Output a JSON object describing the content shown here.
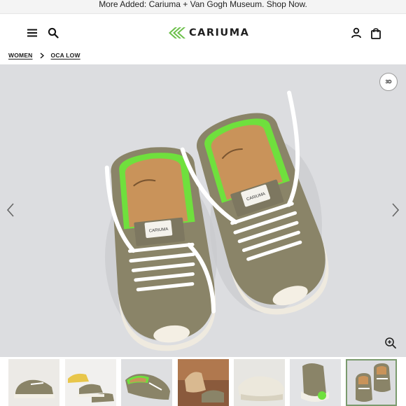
{
  "announcement": {
    "text": "More Added: Cariuma + Van Gogh Museum. Shop Now."
  },
  "header": {
    "logo_text": "CARIUMA",
    "icons": [
      "menu-icon",
      "search-icon",
      "user-icon",
      "shopping-bag-icon"
    ]
  },
  "breadcrumb": {
    "items": [
      "WOMEN",
      "OCA LOW"
    ]
  },
  "gallery": {
    "view_3d_label": "3D",
    "icons": [
      "chevron-left-icon",
      "chevron-right-icon",
      "zoom-in-icon",
      "3d-view-icon"
    ],
    "main_image": "Pair of khaki canvas low-top sneakers with white laces and cork insoles, top-down view",
    "thumbnails_count": 7,
    "active_thumbnail": 7
  },
  "colors": {
    "brand_green": "#6cc04a",
    "stage_background": "#dcdde0",
    "shoe_canvas": "#8a8468",
    "insole_cork": "#c9935a",
    "lining_green": "#7be04a",
    "active_thumb_outline": "#7a9a6e"
  }
}
